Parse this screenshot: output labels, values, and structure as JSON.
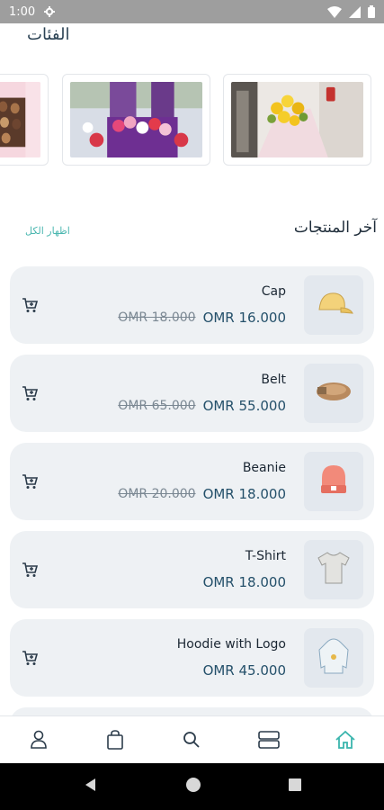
{
  "status_bar": {
    "time": "1:00"
  },
  "categories": {
    "title": "الفئات"
  },
  "latest": {
    "title": "آخر المنتجات",
    "show_all": "اظهار الكل"
  },
  "products": [
    {
      "name": "Cap",
      "old_price": "OMR 18.000",
      "price": "OMR 16.000",
      "icon": "cap-icon"
    },
    {
      "name": "Belt",
      "old_price": "OMR 65.000",
      "price": "OMR 55.000",
      "icon": "belt-icon"
    },
    {
      "name": "Beanie",
      "old_price": "OMR 20.000",
      "price": "OMR 18.000",
      "icon": "beanie-icon"
    },
    {
      "name": "T-Shirt",
      "old_price": "",
      "price": "OMR 18.000",
      "icon": "tshirt-icon"
    },
    {
      "name": "Hoodie with Logo",
      "old_price": "",
      "price": "OMR 45.000",
      "icon": "hoodie-icon"
    }
  ],
  "bottom_nav": [
    "profile-icon",
    "bag-icon",
    "search-icon",
    "categories-icon",
    "home-icon"
  ],
  "colors": {
    "accent": "#3ab5ad",
    "card_bg": "#eef1f4",
    "price": "#24506a"
  }
}
